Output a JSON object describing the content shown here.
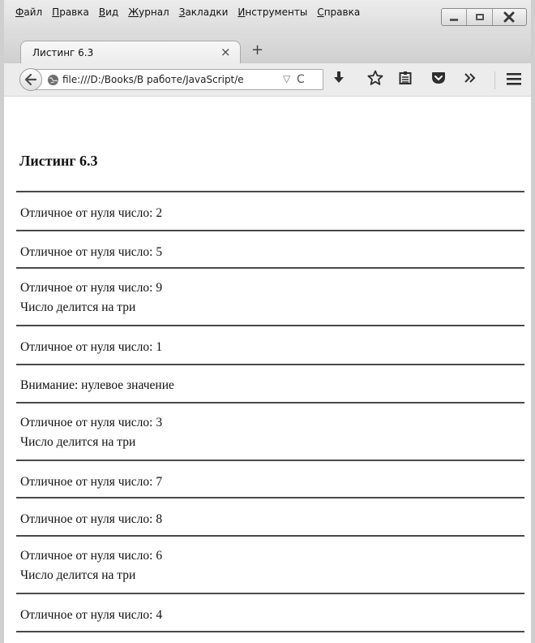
{
  "menu": [
    {
      "underlined": "Ф",
      "rest": "айл"
    },
    {
      "underlined": "П",
      "rest": "равка"
    },
    {
      "underlined": "В",
      "rest": "ид"
    },
    {
      "underlined": "Ж",
      "rest": "урнал"
    },
    {
      "underlined": "З",
      "rest": "акладки"
    },
    {
      "underlined": "И",
      "rest": "нструменты"
    },
    {
      "underlined": "С",
      "rest": "правка"
    }
  ],
  "tab": {
    "title": "Листинг 6.3",
    "close_glyph": "×",
    "new_tab_glyph": "+"
  },
  "navbar": {
    "url": "file:///D:/Books/В работе/JavaScript/e",
    "dropmarker_glyph": "▽",
    "reload_glyph": "C"
  },
  "page": {
    "heading": "Листинг 6.3",
    "blocks": [
      [
        "Отличное от нуля число: 2"
      ],
      [
        "Отличное от нуля число: 5"
      ],
      [
        "Отличное от нуля число: 9",
        "Число делится на три"
      ],
      [
        "Отличное от нуля число: 1"
      ],
      [
        "Внимание: нулевое значение"
      ],
      [
        "Отличное от нуля число: 3",
        "Число делится на три"
      ],
      [
        "Отличное от нуля число: 7"
      ],
      [
        "Отличное от нуля число: 8"
      ],
      [
        "Отличное от нуля число: 6",
        "Число делится на три"
      ],
      [
        "Отличное от нуля число: 4"
      ]
    ]
  },
  "colors": {
    "chrome_bg": "#dcdcdc",
    "rule": "#4a4a4a",
    "text": "#111111"
  },
  "icons": [
    "back-arrow-icon",
    "globe-icon",
    "download-icon",
    "bookmark-star-icon",
    "reading-list-icon",
    "pocket-icon",
    "overflow-chevron-icon",
    "hamburger-menu-icon"
  ]
}
